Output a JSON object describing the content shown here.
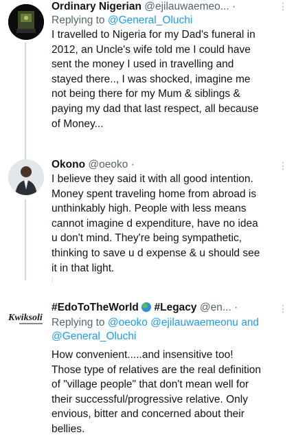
{
  "tweets": [
    {
      "name": "Ordinary Nigerian",
      "handle": "@ejilauwaemeo...",
      "time": "·",
      "reply_prefix": "Replying to",
      "reply_to": "@General_Oluchi",
      "body_lines": [
        "I travelled to Nigeria for my Dad's funeral in",
        "2012, an Uncle's wife told me I could have",
        "sent the money I used in travelling and",
        "stayed there.., I was shocked, imagine me",
        "not being there for my Mum & siblings &",
        "paying my dad that last respect, all because",
        "of Money..."
      ]
    },
    {
      "name": "Okono",
      "handle": "@oeoko",
      "time": "·",
      "body_lines": [
        "I believe they said it with all good intention.",
        "Money spent traveling home from abroad is",
        "unthinkably high. People with less means",
        "cannot imagine d expenditure, have no idea",
        "u don't mind. They're being sympathetic,",
        "thinking to save u d expense & u should see",
        "it in that light."
      ]
    },
    {
      "name_part1": "#EdoToTheWorld",
      "name_part2": "#Legacy",
      "handle": "@en...",
      "time": "·",
      "reply_prefix": "Replying to",
      "reply_to_line1": "@oeoko @ejilauwaemeonu and",
      "reply_to_line2": "@General_Oluchi",
      "avatar_text": "Kwiksoli",
      "body_lines": [
        "How convenient.....and insensitive too!",
        "Those type of relatives are the real definition",
        "of \"village people\" that don't mean well for",
        "their successful/progressive relative. Only",
        "envious, bitter and concerned about their",
        "bellies."
      ]
    }
  ],
  "more_icon": "⋮"
}
